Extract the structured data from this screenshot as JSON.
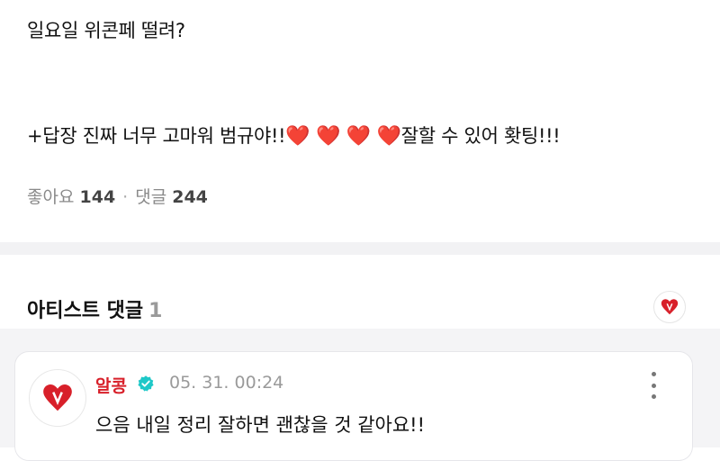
{
  "post": {
    "line1": "일요일 위콘페 떨려?",
    "line2_text": "+답장 진짜 너무 고마워 범규야!!",
    "hearts": "❤️ ❤️ ❤️ ❤️",
    "line2_tail": "잘할 수 있어 홧팅!!!"
  },
  "stats": {
    "likes_label": "좋아요",
    "likes_count": "144",
    "separator": "·",
    "comments_label": "댓글",
    "comments_count": "244"
  },
  "artist_comments": {
    "title": "아티스트 댓글",
    "count": "1"
  },
  "comment": {
    "author": "알콩",
    "timestamp": "05. 31. 00:24",
    "text": "으음 내일 정리 잘하면 괜찮을 것 같아요!!"
  },
  "colors": {
    "heart": "#e0181e",
    "author": "#d8202a",
    "verified": "#1ec8c8"
  },
  "icons": {
    "heart": "heart-icon",
    "verified": "verified-badge-icon",
    "more": "more-vertical-icon"
  }
}
